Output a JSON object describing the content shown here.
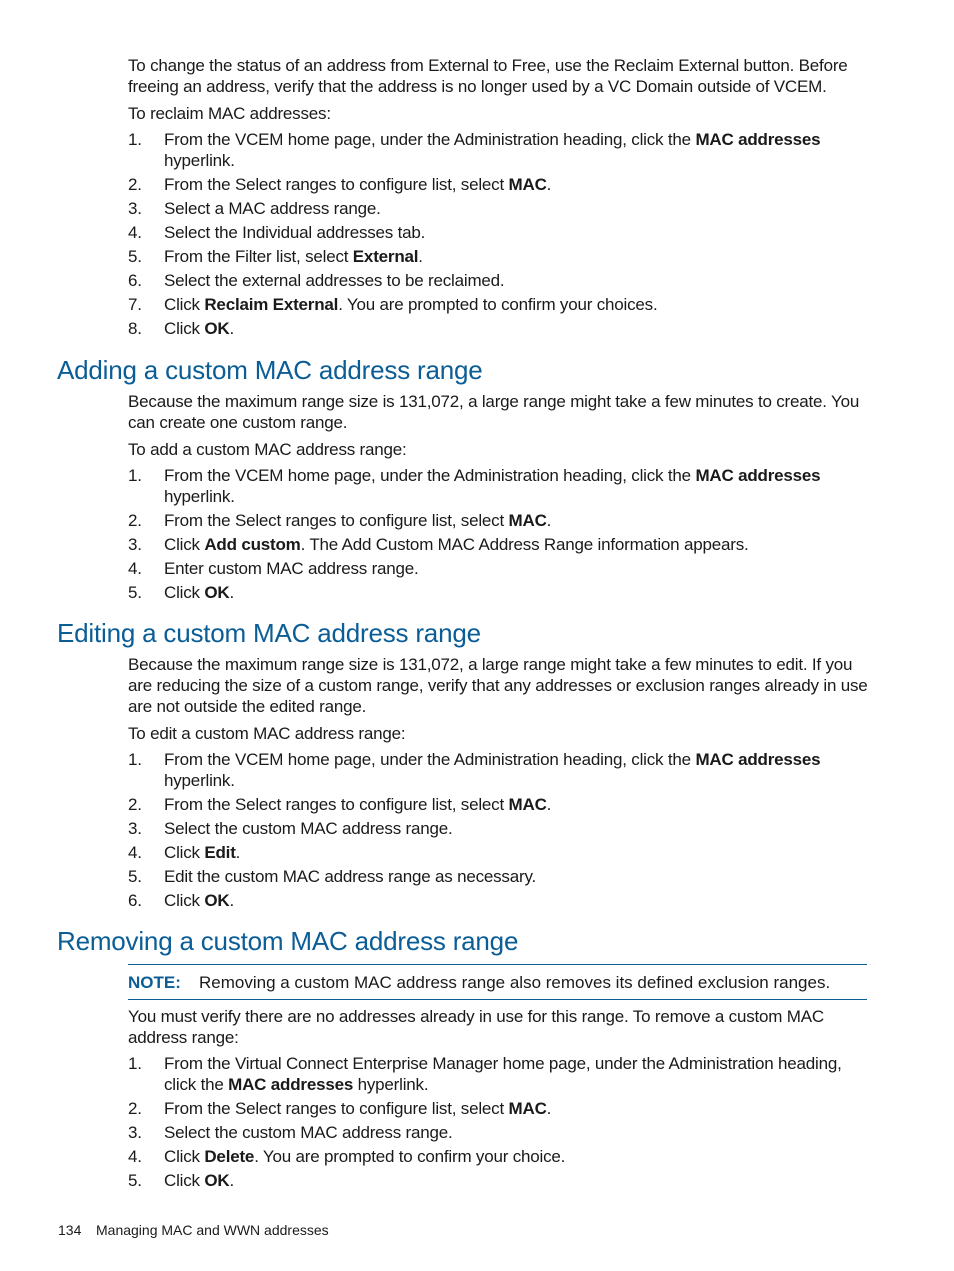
{
  "intro": {
    "paragraph": "To change the status of an address from External to Free, use the Reclaim External button. Before freeing an address, verify that the address is no longer used by a VC Domain outside of VCEM.",
    "lead": "To reclaim MAC addresses:",
    "steps": [
      {
        "num": "1.",
        "pre": "From the VCEM home page, under the Administration heading, click the ",
        "bold": "MAC addresses",
        "post": " hyperlink."
      },
      {
        "num": "2.",
        "pre": "From the Select ranges to configure list, select ",
        "bold": "MAC",
        "post": "."
      },
      {
        "num": "3.",
        "pre": "Select a MAC address range.",
        "bold": "",
        "post": ""
      },
      {
        "num": "4.",
        "pre": "Select the Individual addresses tab.",
        "bold": "",
        "post": ""
      },
      {
        "num": "5.",
        "pre": "From the Filter list, select ",
        "bold": "External",
        "post": "."
      },
      {
        "num": "6.",
        "pre": "Select the external addresses to be reclaimed.",
        "bold": "",
        "post": ""
      },
      {
        "num": "7.",
        "pre": "Click ",
        "bold": "Reclaim External",
        "post": ". You are prompted to confirm your choices."
      },
      {
        "num": "8.",
        "pre": "Click ",
        "bold": "OK",
        "post": "."
      }
    ]
  },
  "adding": {
    "heading": "Adding a custom MAC address range",
    "paragraph": "Because the maximum range size is 131,072, a large range might take a few minutes to create. You can create one custom range.",
    "lead": "To add a custom MAC address range:",
    "steps": [
      {
        "num": "1.",
        "pre": "From the VCEM home page, under the Administration heading, click the ",
        "bold": "MAC addresses",
        "post": " hyperlink."
      },
      {
        "num": "2.",
        "pre": "From the Select ranges to configure list, select ",
        "bold": "MAC",
        "post": "."
      },
      {
        "num": "3.",
        "pre": "Click ",
        "bold": "Add custom",
        "post": ". The Add Custom MAC Address Range information appears."
      },
      {
        "num": "4.",
        "pre": "Enter custom MAC address range.",
        "bold": "",
        "post": ""
      },
      {
        "num": "5.",
        "pre": "Click ",
        "bold": "OK",
        "post": "."
      }
    ]
  },
  "editing": {
    "heading": "Editing a custom MAC address range",
    "paragraph": "Because the maximum range size is 131,072, a large range might take a few minutes to edit. If you are reducing the size of a custom range, verify that any addresses or exclusion ranges already in use are not outside the edited range.",
    "lead": "To edit a custom MAC address range:",
    "steps": [
      {
        "num": "1.",
        "pre": "From the VCEM home page, under the Administration heading, click the ",
        "bold": "MAC addresses",
        "post": " hyperlink."
      },
      {
        "num": "2.",
        "pre": "From the Select ranges to configure list, select ",
        "bold": "MAC",
        "post": "."
      },
      {
        "num": "3.",
        "pre": "Select the custom MAC address range.",
        "bold": "",
        "post": ""
      },
      {
        "num": "4.",
        "pre": "Click ",
        "bold": "Edit",
        "post": "."
      },
      {
        "num": "5.",
        "pre": "Edit the custom MAC address range as necessary.",
        "bold": "",
        "post": ""
      },
      {
        "num": "6.",
        "pre": "Click ",
        "bold": "OK",
        "post": "."
      }
    ]
  },
  "removing": {
    "heading": "Removing a custom MAC address range",
    "note_label": "NOTE:",
    "note_text": "Removing a custom MAC address range also removes its defined exclusion ranges.",
    "paragraph": "You must verify there are no addresses already in use for this range. To remove a custom MAC address range:",
    "steps": [
      {
        "num": "1.",
        "pre": "From the Virtual Connect Enterprise Manager home page, under the Administration heading, click the ",
        "bold": "MAC addresses",
        "post": " hyperlink."
      },
      {
        "num": "2.",
        "pre": "From the Select ranges to configure list, select ",
        "bold": "MAC",
        "post": "."
      },
      {
        "num": "3.",
        "pre": "Select the custom MAC address range.",
        "bold": "",
        "post": ""
      },
      {
        "num": "4.",
        "pre": "Click ",
        "bold": "Delete",
        "post": ". You are prompted to confirm your choice."
      },
      {
        "num": "5.",
        "pre": "Click ",
        "bold": "OK",
        "post": "."
      }
    ]
  },
  "footer": {
    "page_number": "134",
    "section_title": "Managing MAC and WWN addresses"
  },
  "colors": {
    "heading": "#0b5d96",
    "text": "#1a1a1a"
  }
}
